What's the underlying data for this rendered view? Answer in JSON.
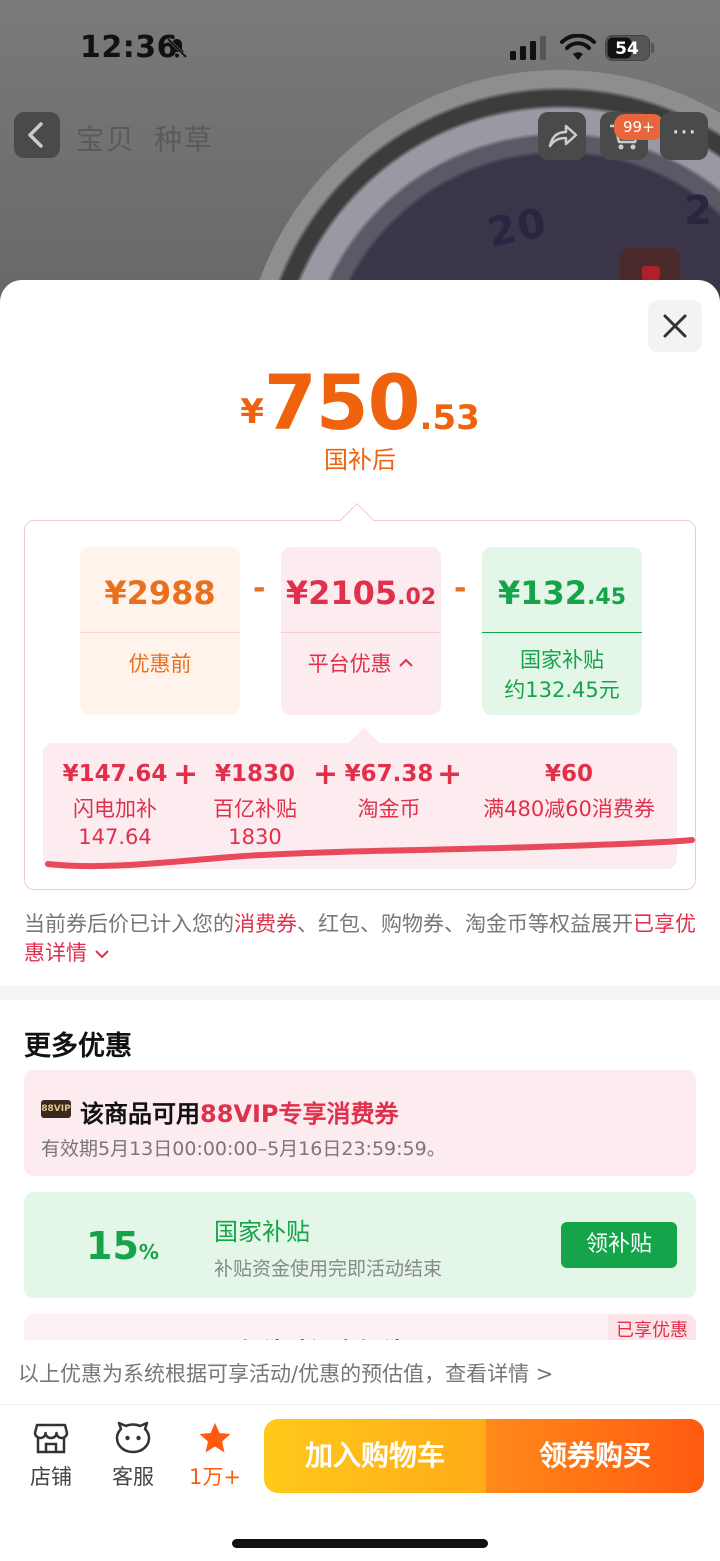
{
  "status_bar": {
    "time": "12:36",
    "battery": "54"
  },
  "nav": {
    "tabs": [
      "宝贝",
      "种草"
    ],
    "cart_badge": "99+",
    "more": "···"
  },
  "background_watch": {
    "numeral": "20",
    "numeral_partial": "2"
  },
  "price": {
    "currency": "¥",
    "integer": "750",
    "decimal": ".53",
    "label": "国补后"
  },
  "breakdown": {
    "original": {
      "currency": "¥",
      "integer": "2988",
      "decimal": "",
      "label": "优惠前"
    },
    "minus1": "-",
    "platform": {
      "currency": "¥",
      "integer": "2105",
      "decimal": ".02",
      "label": "平台优惠"
    },
    "minus2": "-",
    "gov": {
      "currency": "¥",
      "integer": "132",
      "decimal": ".45",
      "label": "国家补贴",
      "sub": "约132.45元"
    }
  },
  "details": [
    {
      "value": "¥147.64",
      "label": "闪电加补",
      "sub": "147.64"
    },
    {
      "value": "¥1830",
      "label": "百亿补贴",
      "sub": "1830"
    },
    {
      "value": "¥67.38",
      "label": "淘金币",
      "sub": ""
    },
    {
      "value": "¥60",
      "label": "满480减60消费券",
      "sub": ""
    }
  ],
  "plus": "+",
  "notice": {
    "part1": "当前券后价已计入您的",
    "hl1": "消费券",
    "part2": "、红包、购物券、淘金币等权益展开",
    "hl2": "已享优惠详情"
  },
  "more_title": "更多优惠",
  "vip": {
    "badge": "88VIP",
    "title_prefix": "该商品可用",
    "title_hl": "88VIP专享消费券",
    "validity": "有效期5月13日00:00:00–5月16日23:59:59。"
  },
  "gov_subsidy": {
    "percent": "15",
    "percent_sign": "%",
    "title": "国家补贴",
    "sub": "补贴资金使用完即活动结束",
    "button": "领补贴"
  },
  "third_card": {
    "text": "百亿补贴闪电加补",
    "badge": "已享优惠"
  },
  "estimate": "以上优惠为系统根据可享活动/优惠的预估值，查看详情 >",
  "bottom": {
    "store": "店铺",
    "service": "客服",
    "favorite": "1万+",
    "add_cart": "加入购物车",
    "buy": "领券购买"
  },
  "colors": {
    "orange": "#f0630e",
    "red": "#e0304c",
    "green": "#15a44a"
  }
}
